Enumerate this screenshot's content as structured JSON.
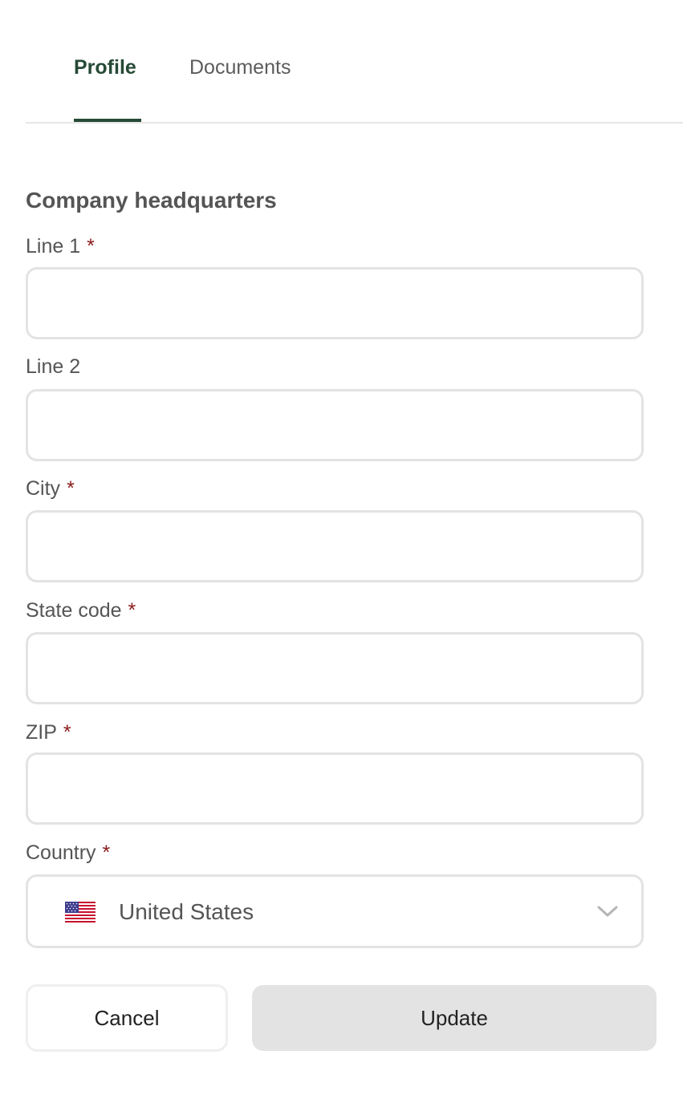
{
  "tabs": [
    {
      "label": "Profile",
      "active": true
    },
    {
      "label": "Documents",
      "active": false
    }
  ],
  "section": {
    "title": "Company headquarters"
  },
  "fields": {
    "line1": {
      "label": "Line 1",
      "required_mark": "*",
      "value": "",
      "placeholder": ""
    },
    "line2": {
      "label": "Line 2",
      "value": "",
      "placeholder": ""
    },
    "city": {
      "label": "City",
      "required_mark": "*",
      "value": "",
      "placeholder": ""
    },
    "state_code": {
      "label": "State code",
      "required_mark": "*",
      "value": "",
      "placeholder": ""
    },
    "zip": {
      "label": "ZIP",
      "required_mark": "*",
      "value": "",
      "placeholder": ""
    },
    "country": {
      "label": "Country",
      "required_mark": "*",
      "value": "United States",
      "flag_icon": "us-flag-icon"
    }
  },
  "buttons": {
    "cancel": "Cancel",
    "update": "Update"
  },
  "colors": {
    "accent": "#264a36",
    "required": "#8b1a1a",
    "border": "#e3e3e3",
    "disabled_button": "#e3e3e3"
  }
}
